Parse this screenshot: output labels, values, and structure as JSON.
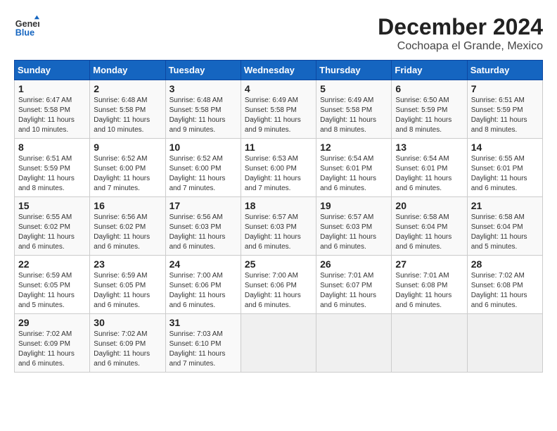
{
  "logo": {
    "line1": "General",
    "line2": "Blue"
  },
  "header": {
    "month": "December 2024",
    "location": "Cochoapa el Grande, Mexico"
  },
  "weekdays": [
    "Sunday",
    "Monday",
    "Tuesday",
    "Wednesday",
    "Thursday",
    "Friday",
    "Saturday"
  ],
  "weeks": [
    [
      {
        "day": "1",
        "info": "Sunrise: 6:47 AM\nSunset: 5:58 PM\nDaylight: 11 hours\nand 10 minutes."
      },
      {
        "day": "2",
        "info": "Sunrise: 6:48 AM\nSunset: 5:58 PM\nDaylight: 11 hours\nand 10 minutes."
      },
      {
        "day": "3",
        "info": "Sunrise: 6:48 AM\nSunset: 5:58 PM\nDaylight: 11 hours\nand 9 minutes."
      },
      {
        "day": "4",
        "info": "Sunrise: 6:49 AM\nSunset: 5:58 PM\nDaylight: 11 hours\nand 9 minutes."
      },
      {
        "day": "5",
        "info": "Sunrise: 6:49 AM\nSunset: 5:58 PM\nDaylight: 11 hours\nand 8 minutes."
      },
      {
        "day": "6",
        "info": "Sunrise: 6:50 AM\nSunset: 5:59 PM\nDaylight: 11 hours\nand 8 minutes."
      },
      {
        "day": "7",
        "info": "Sunrise: 6:51 AM\nSunset: 5:59 PM\nDaylight: 11 hours\nand 8 minutes."
      }
    ],
    [
      {
        "day": "8",
        "info": "Sunrise: 6:51 AM\nSunset: 5:59 PM\nDaylight: 11 hours\nand 8 minutes."
      },
      {
        "day": "9",
        "info": "Sunrise: 6:52 AM\nSunset: 6:00 PM\nDaylight: 11 hours\nand 7 minutes."
      },
      {
        "day": "10",
        "info": "Sunrise: 6:52 AM\nSunset: 6:00 PM\nDaylight: 11 hours\nand 7 minutes."
      },
      {
        "day": "11",
        "info": "Sunrise: 6:53 AM\nSunset: 6:00 PM\nDaylight: 11 hours\nand 7 minutes."
      },
      {
        "day": "12",
        "info": "Sunrise: 6:54 AM\nSunset: 6:01 PM\nDaylight: 11 hours\nand 6 minutes."
      },
      {
        "day": "13",
        "info": "Sunrise: 6:54 AM\nSunset: 6:01 PM\nDaylight: 11 hours\nand 6 minutes."
      },
      {
        "day": "14",
        "info": "Sunrise: 6:55 AM\nSunset: 6:01 PM\nDaylight: 11 hours\nand 6 minutes."
      }
    ],
    [
      {
        "day": "15",
        "info": "Sunrise: 6:55 AM\nSunset: 6:02 PM\nDaylight: 11 hours\nand 6 minutes."
      },
      {
        "day": "16",
        "info": "Sunrise: 6:56 AM\nSunset: 6:02 PM\nDaylight: 11 hours\nand 6 minutes."
      },
      {
        "day": "17",
        "info": "Sunrise: 6:56 AM\nSunset: 6:03 PM\nDaylight: 11 hours\nand 6 minutes."
      },
      {
        "day": "18",
        "info": "Sunrise: 6:57 AM\nSunset: 6:03 PM\nDaylight: 11 hours\nand 6 minutes."
      },
      {
        "day": "19",
        "info": "Sunrise: 6:57 AM\nSunset: 6:03 PM\nDaylight: 11 hours\nand 6 minutes."
      },
      {
        "day": "20",
        "info": "Sunrise: 6:58 AM\nSunset: 6:04 PM\nDaylight: 11 hours\nand 6 minutes."
      },
      {
        "day": "21",
        "info": "Sunrise: 6:58 AM\nSunset: 6:04 PM\nDaylight: 11 hours\nand 5 minutes."
      }
    ],
    [
      {
        "day": "22",
        "info": "Sunrise: 6:59 AM\nSunset: 6:05 PM\nDaylight: 11 hours\nand 5 minutes."
      },
      {
        "day": "23",
        "info": "Sunrise: 6:59 AM\nSunset: 6:05 PM\nDaylight: 11 hours\nand 6 minutes."
      },
      {
        "day": "24",
        "info": "Sunrise: 7:00 AM\nSunset: 6:06 PM\nDaylight: 11 hours\nand 6 minutes."
      },
      {
        "day": "25",
        "info": "Sunrise: 7:00 AM\nSunset: 6:06 PM\nDaylight: 11 hours\nand 6 minutes."
      },
      {
        "day": "26",
        "info": "Sunrise: 7:01 AM\nSunset: 6:07 PM\nDaylight: 11 hours\nand 6 minutes."
      },
      {
        "day": "27",
        "info": "Sunrise: 7:01 AM\nSunset: 6:08 PM\nDaylight: 11 hours\nand 6 minutes."
      },
      {
        "day": "28",
        "info": "Sunrise: 7:02 AM\nSunset: 6:08 PM\nDaylight: 11 hours\nand 6 minutes."
      }
    ],
    [
      {
        "day": "29",
        "info": "Sunrise: 7:02 AM\nSunset: 6:09 PM\nDaylight: 11 hours\nand 6 minutes."
      },
      {
        "day": "30",
        "info": "Sunrise: 7:02 AM\nSunset: 6:09 PM\nDaylight: 11 hours\nand 6 minutes."
      },
      {
        "day": "31",
        "info": "Sunrise: 7:03 AM\nSunset: 6:10 PM\nDaylight: 11 hours\nand 7 minutes."
      },
      {
        "day": "",
        "info": ""
      },
      {
        "day": "",
        "info": ""
      },
      {
        "day": "",
        "info": ""
      },
      {
        "day": "",
        "info": ""
      }
    ]
  ]
}
